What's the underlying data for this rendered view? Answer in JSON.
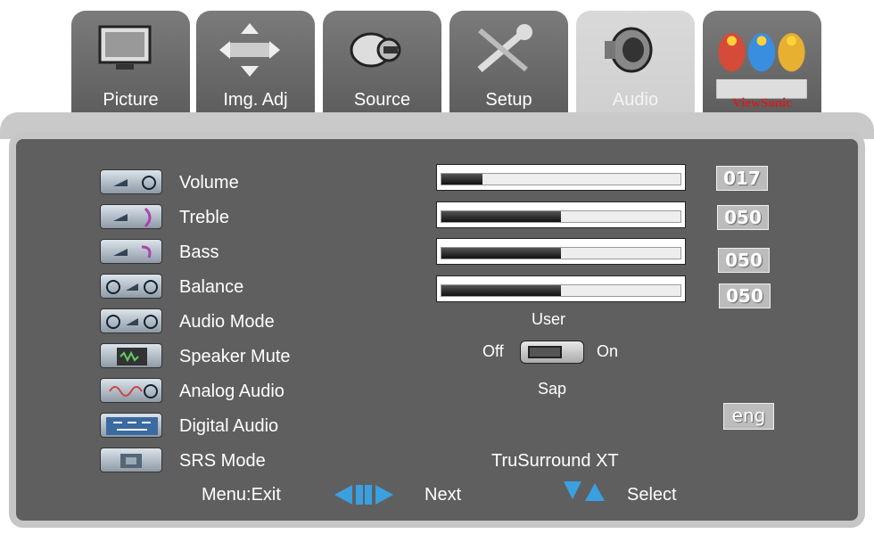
{
  "tabs": [
    {
      "label": "Picture",
      "icon": "monitor-icon"
    },
    {
      "label": "Img. Adj",
      "icon": "arrows-icon"
    },
    {
      "label": "Source",
      "icon": "source-plug-icon"
    },
    {
      "label": "Setup",
      "icon": "wrench-icon"
    },
    {
      "label": "Audio",
      "icon": "speaker-icon",
      "active": true
    },
    {
      "label": "",
      "icon": "viewsonic-logo"
    }
  ],
  "logo_text": "ViewSonic",
  "rows": {
    "volume": {
      "label": "Volume",
      "value": "017",
      "level": 0.17
    },
    "treble": {
      "label": "Treble",
      "value": "050",
      "level": 0.5
    },
    "bass": {
      "label": "Bass",
      "value": "050",
      "level": 0.5
    },
    "balance": {
      "label": "Balance",
      "value": "050",
      "level": 0.5
    },
    "audio_mode": {
      "label": "Audio Mode",
      "value": "User"
    },
    "speaker_mute": {
      "label": "Speaker Mute",
      "off": "Off",
      "on": "On",
      "state": "off"
    },
    "analog_audio": {
      "label": "Analog Audio",
      "value": "Sap"
    },
    "digital_audio": {
      "label": "Digital Audio",
      "value": "eng"
    },
    "srs_mode": {
      "label": "SRS Mode",
      "value": "TruSurround XT"
    }
  },
  "footer": {
    "exit": "Menu:Exit",
    "next": "Next",
    "select": "Select"
  },
  "colors": {
    "panel": "#5f5f5f",
    "tab": "#6b6b6b",
    "active_tab": "#d4d4d4",
    "arrow": "#3aa0e0"
  }
}
